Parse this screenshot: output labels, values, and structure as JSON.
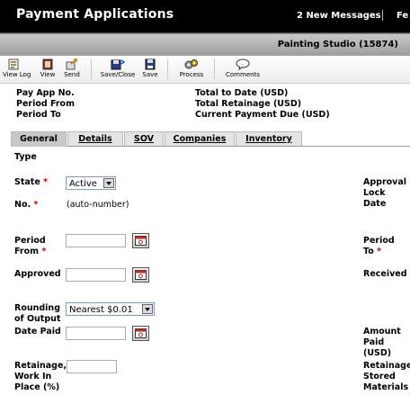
{
  "header": {
    "title": "Payment Applications",
    "messages": "2 New Messages",
    "cut_label": "Fe"
  },
  "project": {
    "name": "Painting Studio (15874)"
  },
  "toolbar": {
    "view_log": "View Log",
    "view": "View",
    "send": "Send",
    "save_close": "Save/Close",
    "save": "Save",
    "process": "Process",
    "comments": "Comments"
  },
  "summary": {
    "pay_app_no": "Pay App No.",
    "period_from": "Period From",
    "period_to": "Period To",
    "total_to_date": "Total to Date (USD)",
    "total_retainage": "Total Retainage (USD)",
    "current_payment_due": "Current Payment Due (USD)"
  },
  "tabs": [
    {
      "label": "General"
    },
    {
      "label": "Details"
    },
    {
      "label": "SOV"
    },
    {
      "label": "Companies"
    },
    {
      "label": "Inventory"
    }
  ],
  "form": {
    "type_label": "Type",
    "state_label": "State",
    "state_value": "Active",
    "no_label": "No.",
    "no_value": "(auto-number)",
    "period_from_label_1": "Period",
    "period_from_label_2": "From",
    "approved_label": "Approved",
    "rounding_label_1": "Rounding",
    "rounding_label_2": "of Output",
    "rounding_value": "Nearest $0.01",
    "date_paid_label": "Date Paid",
    "retainage_label_1": "Retainage,",
    "retainage_label_2": "Work In",
    "retainage_label_3": "Place (%)",
    "required_mark": "*",
    "approval_lock_1": "Approval",
    "approval_lock_2": "Lock",
    "approval_lock_3": "Date",
    "period_to_label_1": "Period",
    "period_to_label_2": "To",
    "received_label": "Received",
    "amount_paid_1": "Amount",
    "amount_paid_2": "Paid",
    "amount_paid_3": "(USD)",
    "retainage_stored_1": "Retainage,",
    "retainage_stored_2": "Stored",
    "retainage_stored_3": "Materials"
  }
}
